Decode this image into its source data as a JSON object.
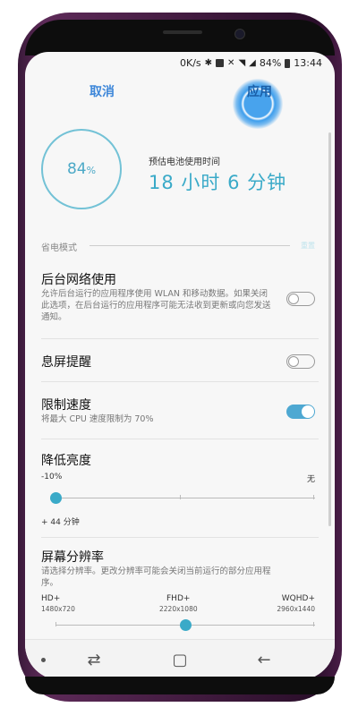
{
  "statusbar": {
    "speed": "0K/s",
    "battery": "84%",
    "time": "13:44"
  },
  "header": {
    "cancel_label": "取消",
    "apply_label": "应用"
  },
  "battery": {
    "percent": "84",
    "percent_unit": "%",
    "estimate_label": "预估电池使用时间",
    "estimate_value": "18 小时 6 分钟"
  },
  "section": {
    "label": "省电模式",
    "reset_label": "重置"
  },
  "settings": {
    "background_network": {
      "title": "后台网络使用",
      "desc": "允许后台运行的应用程序使用 WLAN 和移动数据。如果关闭此选项，在后台运行的应用程序可能无法收到更新或向您发送通知。",
      "enabled": false
    },
    "always_on": {
      "title": "息屏提醒",
      "enabled": false
    },
    "limit_speed": {
      "title": "限制速度",
      "desc": "将最大 CPU 速度限制为 70%",
      "enabled": true
    },
    "brightness": {
      "title": "降低亮度",
      "min_label": "-10%",
      "max_label": "无",
      "extra_label": "+ 44 分钟",
      "value_fraction": 0
    },
    "resolution": {
      "title": "屏幕分辨率",
      "desc": "请选择分辨率。更改分辨率可能会关闭当前运行的部分应用程序。",
      "options": [
        {
          "name": "HD+",
          "size": "1480x720"
        },
        {
          "name": "FHD+",
          "size": "2220x1080"
        },
        {
          "name": "WQHD+",
          "size": "2960x1440"
        }
      ],
      "selected_index": 1
    }
  },
  "colors": {
    "accent": "#3aaac8",
    "link": "#3e87d9",
    "tap_highlight": "#2994eb"
  }
}
